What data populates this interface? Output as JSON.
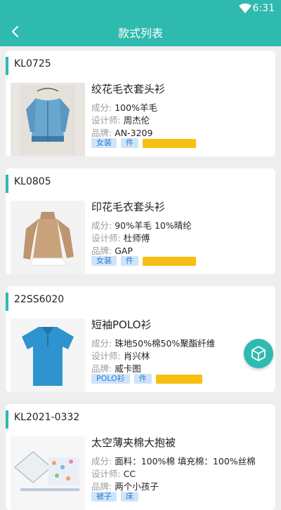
{
  "status_bar": {
    "time": "6:31",
    "wifi_icon": "wifi-icon"
  },
  "header": {
    "title": "款式列表",
    "back_icon": "chevron-left-icon"
  },
  "labels": {
    "composition": "成分:",
    "designer": "设计师:",
    "brand": "品牌:"
  },
  "styles": [
    {
      "code": "KL0725",
      "name": "绞花毛衣套头衫",
      "composition": "100%羊毛",
      "designer": "周杰伦",
      "brand": "AN-3209",
      "tags": [
        "女装",
        "件"
      ],
      "image": "blue-cardigan-photo"
    },
    {
      "code": "KL0805",
      "name": "印花毛衣套头衫",
      "composition": "90%羊毛 10%晴纶",
      "designer": "杜师傅",
      "brand": "GAP",
      "tags": [
        "女装",
        "件"
      ],
      "image": "beige-sweater-photo"
    },
    {
      "code": "22SS6020",
      "name": "短袖POLO衫",
      "composition": "珠地50%棉50%聚酯纤维",
      "designer": "肖兴林",
      "brand": "威卡图",
      "tags": [
        "POLO衫",
        "件"
      ],
      "image": "blue-polo-photo"
    },
    {
      "code": "KL2021-0332",
      "name": "太空薄夹棉大抱被",
      "composition": "面料：100%棉 填充棉：100%丝棉",
      "designer": "CC",
      "brand": "两个小孩子",
      "tags": [
        "被子",
        "床"
      ],
      "image": "baby-quilt-photo"
    }
  ],
  "colors": {
    "primary": "#2fbab0",
    "tag_bg": "#cfe4fb",
    "tag_text": "#2b7bc8",
    "yellow_bar": "#f7bf12"
  },
  "fab": {
    "icon": "cube-icon"
  }
}
